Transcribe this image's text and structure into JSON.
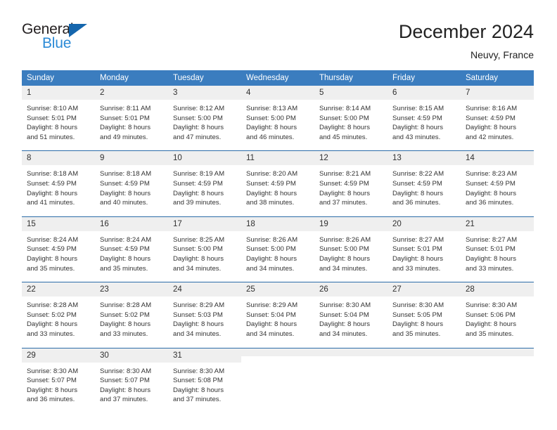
{
  "logo": {
    "word_one": "General",
    "word_two": "Blue",
    "triangle_icon": "blue-triangle-icon",
    "accent_dark": "#1566ad",
    "accent_light": "#2b8ad6"
  },
  "header": {
    "title": "December 2024",
    "location": "Neuvy, France"
  },
  "theme": {
    "header_blue": "#3b7dbf",
    "row_rule_blue": "#2b6ca8",
    "day_band_gray": "#efefef",
    "text": "#333333"
  },
  "weekdays": [
    "Sunday",
    "Monday",
    "Tuesday",
    "Wednesday",
    "Thursday",
    "Friday",
    "Saturday"
  ],
  "weeks": [
    [
      {
        "day": "1",
        "sunrise": "Sunrise: 8:10 AM",
        "sunset": "Sunset: 5:01 PM",
        "daylight1": "Daylight: 8 hours",
        "daylight2": "and 51 minutes."
      },
      {
        "day": "2",
        "sunrise": "Sunrise: 8:11 AM",
        "sunset": "Sunset: 5:01 PM",
        "daylight1": "Daylight: 8 hours",
        "daylight2": "and 49 minutes."
      },
      {
        "day": "3",
        "sunrise": "Sunrise: 8:12 AM",
        "sunset": "Sunset: 5:00 PM",
        "daylight1": "Daylight: 8 hours",
        "daylight2": "and 47 minutes."
      },
      {
        "day": "4",
        "sunrise": "Sunrise: 8:13 AM",
        "sunset": "Sunset: 5:00 PM",
        "daylight1": "Daylight: 8 hours",
        "daylight2": "and 46 minutes."
      },
      {
        "day": "5",
        "sunrise": "Sunrise: 8:14 AM",
        "sunset": "Sunset: 5:00 PM",
        "daylight1": "Daylight: 8 hours",
        "daylight2": "and 45 minutes."
      },
      {
        "day": "6",
        "sunrise": "Sunrise: 8:15 AM",
        "sunset": "Sunset: 4:59 PM",
        "daylight1": "Daylight: 8 hours",
        "daylight2": "and 43 minutes."
      },
      {
        "day": "7",
        "sunrise": "Sunrise: 8:16 AM",
        "sunset": "Sunset: 4:59 PM",
        "daylight1": "Daylight: 8 hours",
        "daylight2": "and 42 minutes."
      }
    ],
    [
      {
        "day": "8",
        "sunrise": "Sunrise: 8:18 AM",
        "sunset": "Sunset: 4:59 PM",
        "daylight1": "Daylight: 8 hours",
        "daylight2": "and 41 minutes."
      },
      {
        "day": "9",
        "sunrise": "Sunrise: 8:18 AM",
        "sunset": "Sunset: 4:59 PM",
        "daylight1": "Daylight: 8 hours",
        "daylight2": "and 40 minutes."
      },
      {
        "day": "10",
        "sunrise": "Sunrise: 8:19 AM",
        "sunset": "Sunset: 4:59 PM",
        "daylight1": "Daylight: 8 hours",
        "daylight2": "and 39 minutes."
      },
      {
        "day": "11",
        "sunrise": "Sunrise: 8:20 AM",
        "sunset": "Sunset: 4:59 PM",
        "daylight1": "Daylight: 8 hours",
        "daylight2": "and 38 minutes."
      },
      {
        "day": "12",
        "sunrise": "Sunrise: 8:21 AM",
        "sunset": "Sunset: 4:59 PM",
        "daylight1": "Daylight: 8 hours",
        "daylight2": "and 37 minutes."
      },
      {
        "day": "13",
        "sunrise": "Sunrise: 8:22 AM",
        "sunset": "Sunset: 4:59 PM",
        "daylight1": "Daylight: 8 hours",
        "daylight2": "and 36 minutes."
      },
      {
        "day": "14",
        "sunrise": "Sunrise: 8:23 AM",
        "sunset": "Sunset: 4:59 PM",
        "daylight1": "Daylight: 8 hours",
        "daylight2": "and 36 minutes."
      }
    ],
    [
      {
        "day": "15",
        "sunrise": "Sunrise: 8:24 AM",
        "sunset": "Sunset: 4:59 PM",
        "daylight1": "Daylight: 8 hours",
        "daylight2": "and 35 minutes."
      },
      {
        "day": "16",
        "sunrise": "Sunrise: 8:24 AM",
        "sunset": "Sunset: 4:59 PM",
        "daylight1": "Daylight: 8 hours",
        "daylight2": "and 35 minutes."
      },
      {
        "day": "17",
        "sunrise": "Sunrise: 8:25 AM",
        "sunset": "Sunset: 5:00 PM",
        "daylight1": "Daylight: 8 hours",
        "daylight2": "and 34 minutes."
      },
      {
        "day": "18",
        "sunrise": "Sunrise: 8:26 AM",
        "sunset": "Sunset: 5:00 PM",
        "daylight1": "Daylight: 8 hours",
        "daylight2": "and 34 minutes."
      },
      {
        "day": "19",
        "sunrise": "Sunrise: 8:26 AM",
        "sunset": "Sunset: 5:00 PM",
        "daylight1": "Daylight: 8 hours",
        "daylight2": "and 34 minutes."
      },
      {
        "day": "20",
        "sunrise": "Sunrise: 8:27 AM",
        "sunset": "Sunset: 5:01 PM",
        "daylight1": "Daylight: 8 hours",
        "daylight2": "and 33 minutes."
      },
      {
        "day": "21",
        "sunrise": "Sunrise: 8:27 AM",
        "sunset": "Sunset: 5:01 PM",
        "daylight1": "Daylight: 8 hours",
        "daylight2": "and 33 minutes."
      }
    ],
    [
      {
        "day": "22",
        "sunrise": "Sunrise: 8:28 AM",
        "sunset": "Sunset: 5:02 PM",
        "daylight1": "Daylight: 8 hours",
        "daylight2": "and 33 minutes."
      },
      {
        "day": "23",
        "sunrise": "Sunrise: 8:28 AM",
        "sunset": "Sunset: 5:02 PM",
        "daylight1": "Daylight: 8 hours",
        "daylight2": "and 33 minutes."
      },
      {
        "day": "24",
        "sunrise": "Sunrise: 8:29 AM",
        "sunset": "Sunset: 5:03 PM",
        "daylight1": "Daylight: 8 hours",
        "daylight2": "and 34 minutes."
      },
      {
        "day": "25",
        "sunrise": "Sunrise: 8:29 AM",
        "sunset": "Sunset: 5:04 PM",
        "daylight1": "Daylight: 8 hours",
        "daylight2": "and 34 minutes."
      },
      {
        "day": "26",
        "sunrise": "Sunrise: 8:30 AM",
        "sunset": "Sunset: 5:04 PM",
        "daylight1": "Daylight: 8 hours",
        "daylight2": "and 34 minutes."
      },
      {
        "day": "27",
        "sunrise": "Sunrise: 8:30 AM",
        "sunset": "Sunset: 5:05 PM",
        "daylight1": "Daylight: 8 hours",
        "daylight2": "and 35 minutes."
      },
      {
        "day": "28",
        "sunrise": "Sunrise: 8:30 AM",
        "sunset": "Sunset: 5:06 PM",
        "daylight1": "Daylight: 8 hours",
        "daylight2": "and 35 minutes."
      }
    ],
    [
      {
        "day": "29",
        "sunrise": "Sunrise: 8:30 AM",
        "sunset": "Sunset: 5:07 PM",
        "daylight1": "Daylight: 8 hours",
        "daylight2": "and 36 minutes."
      },
      {
        "day": "30",
        "sunrise": "Sunrise: 8:30 AM",
        "sunset": "Sunset: 5:07 PM",
        "daylight1": "Daylight: 8 hours",
        "daylight2": "and 37 minutes."
      },
      {
        "day": "31",
        "sunrise": "Sunrise: 8:30 AM",
        "sunset": "Sunset: 5:08 PM",
        "daylight1": "Daylight: 8 hours",
        "daylight2": "and 37 minutes."
      },
      {
        "day": "",
        "sunrise": "",
        "sunset": "",
        "daylight1": "",
        "daylight2": ""
      },
      {
        "day": "",
        "sunrise": "",
        "sunset": "",
        "daylight1": "",
        "daylight2": ""
      },
      {
        "day": "",
        "sunrise": "",
        "sunset": "",
        "daylight1": "",
        "daylight2": ""
      },
      {
        "day": "",
        "sunrise": "",
        "sunset": "",
        "daylight1": "",
        "daylight2": ""
      }
    ]
  ]
}
